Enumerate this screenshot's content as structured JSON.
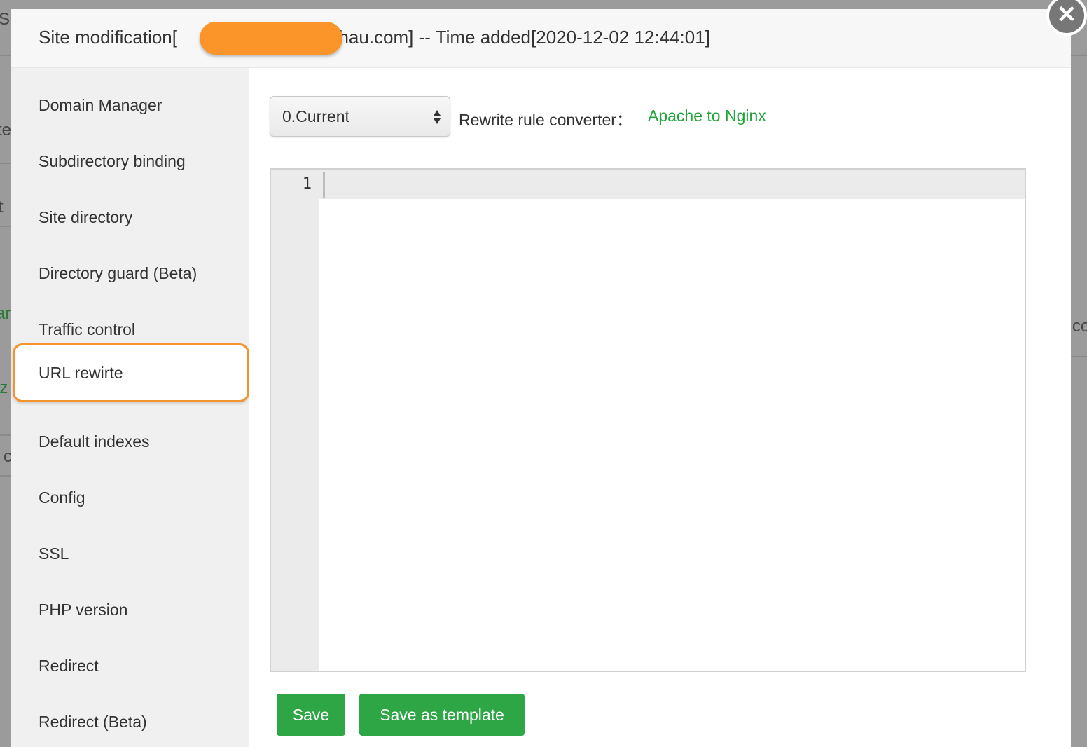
{
  "background": {
    "fragments": [
      "S",
      "te",
      "t",
      "ar",
      "iz",
      "c",
      "co"
    ]
  },
  "modal": {
    "title_prefix": "Site modification[",
    "title_domain_visible": "gchau.com]",
    "title_suffix": " -- Time added[2020-12-02 12:44:01]",
    "close_icon": "close-icon"
  },
  "sidebar": {
    "items": [
      {
        "label": "Domain Manager"
      },
      {
        "label": "Subdirectory binding"
      },
      {
        "label": "Site directory"
      },
      {
        "label": "Directory guard (Beta)"
      },
      {
        "label": "Traffic control"
      },
      {
        "label": "URL rewirte",
        "active": true
      },
      {
        "label": "Default indexes"
      },
      {
        "label": "Config"
      },
      {
        "label": "SSL"
      },
      {
        "label": "PHP version"
      },
      {
        "label": "Redirect"
      },
      {
        "label": "Redirect (Beta)"
      }
    ]
  },
  "content": {
    "template_select": {
      "value": "0.Current"
    },
    "converter_label": "Rewrite rule converter：",
    "converter_link": "Apache to Nginx",
    "editor": {
      "line_numbers": [
        "1"
      ],
      "content": ""
    },
    "buttons": {
      "save": "Save",
      "save_template": "Save as template"
    }
  },
  "colors": {
    "accent_green": "#20a53a",
    "button_green": "#2ea646",
    "highlight_orange": "#f39430",
    "redaction_orange": "#fb952a"
  }
}
